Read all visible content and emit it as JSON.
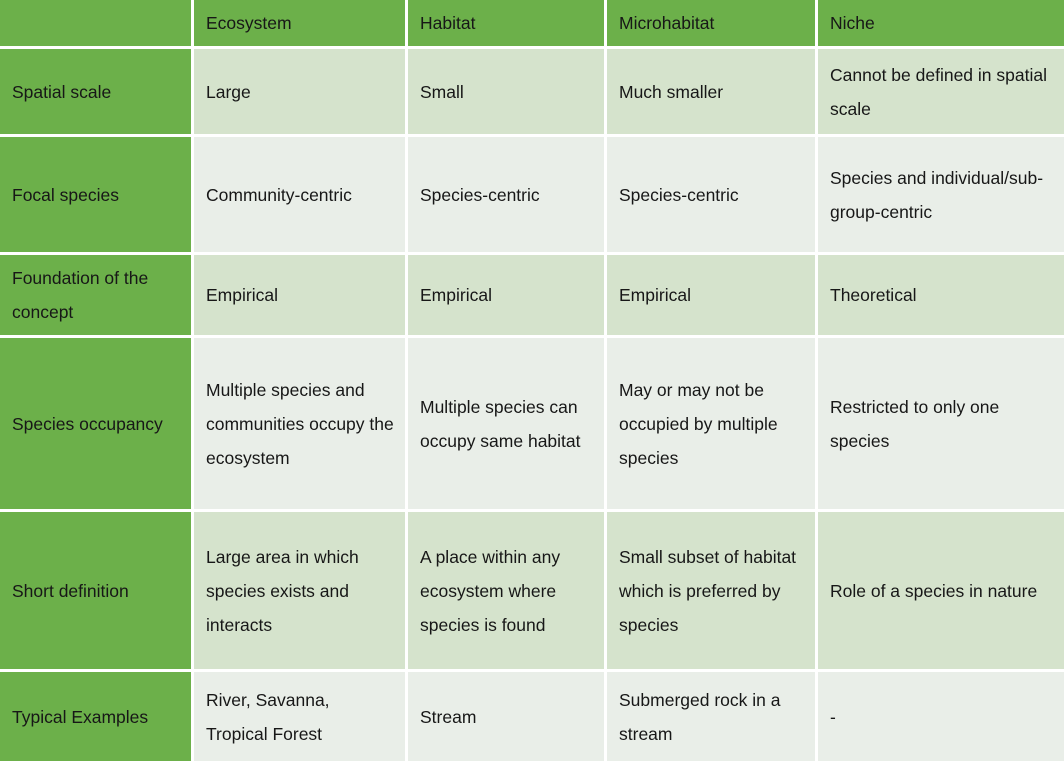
{
  "table": {
    "corner_label": "",
    "columns": [
      {
        "key": "ecosystem",
        "label": "Ecosystem"
      },
      {
        "key": "habitat",
        "label": "Habitat"
      },
      {
        "key": "microhabitat",
        "label": "Microhabitat"
      },
      {
        "key": "niche",
        "label": "Niche"
      }
    ],
    "rows": [
      {
        "label": "Spatial scale",
        "ecosystem": "Large",
        "habitat": "Small",
        "microhabitat": "Much smaller",
        "niche": "Cannot be defined in spatial scale"
      },
      {
        "label": "Focal species",
        "ecosystem": "Community-centric",
        "habitat": "Species-centric",
        "microhabitat": "Species-centric",
        "niche": "Species and individual/sub-group-centric"
      },
      {
        "label": "Foundation of the concept",
        "ecosystem": "Empirical",
        "habitat": "Empirical",
        "microhabitat": "Empirical",
        "niche": "Theoretical"
      },
      {
        "label": "Species occupancy",
        "ecosystem": "Multiple species and communities occupy the ecosystem",
        "habitat": "Multiple species can occupy same habitat",
        "microhabitat": "May or may not be occupied by multiple species",
        "niche": "Restricted to only one species"
      },
      {
        "label": "Short definition",
        "ecosystem": "Large area in which species exists and interacts",
        "habitat": "A place within any ecosystem where species is found",
        "microhabitat": "Small subset of habitat which is preferred by species",
        "niche": "Role of a species in nature"
      },
      {
        "label": "Typical Examples",
        "ecosystem": "River, Savanna, Tropical Forest",
        "habitat": "Stream",
        "microhabitat": "Submerged rock in a stream",
        "niche": "-"
      }
    ]
  },
  "colors": {
    "header_green": "#6cb04a",
    "row_tint_dark": "#d5e3cc",
    "row_tint_light": "#e9eee8",
    "header_text": "#ffffff",
    "body_text": "#171717",
    "grid_line": "#ffffff"
  }
}
